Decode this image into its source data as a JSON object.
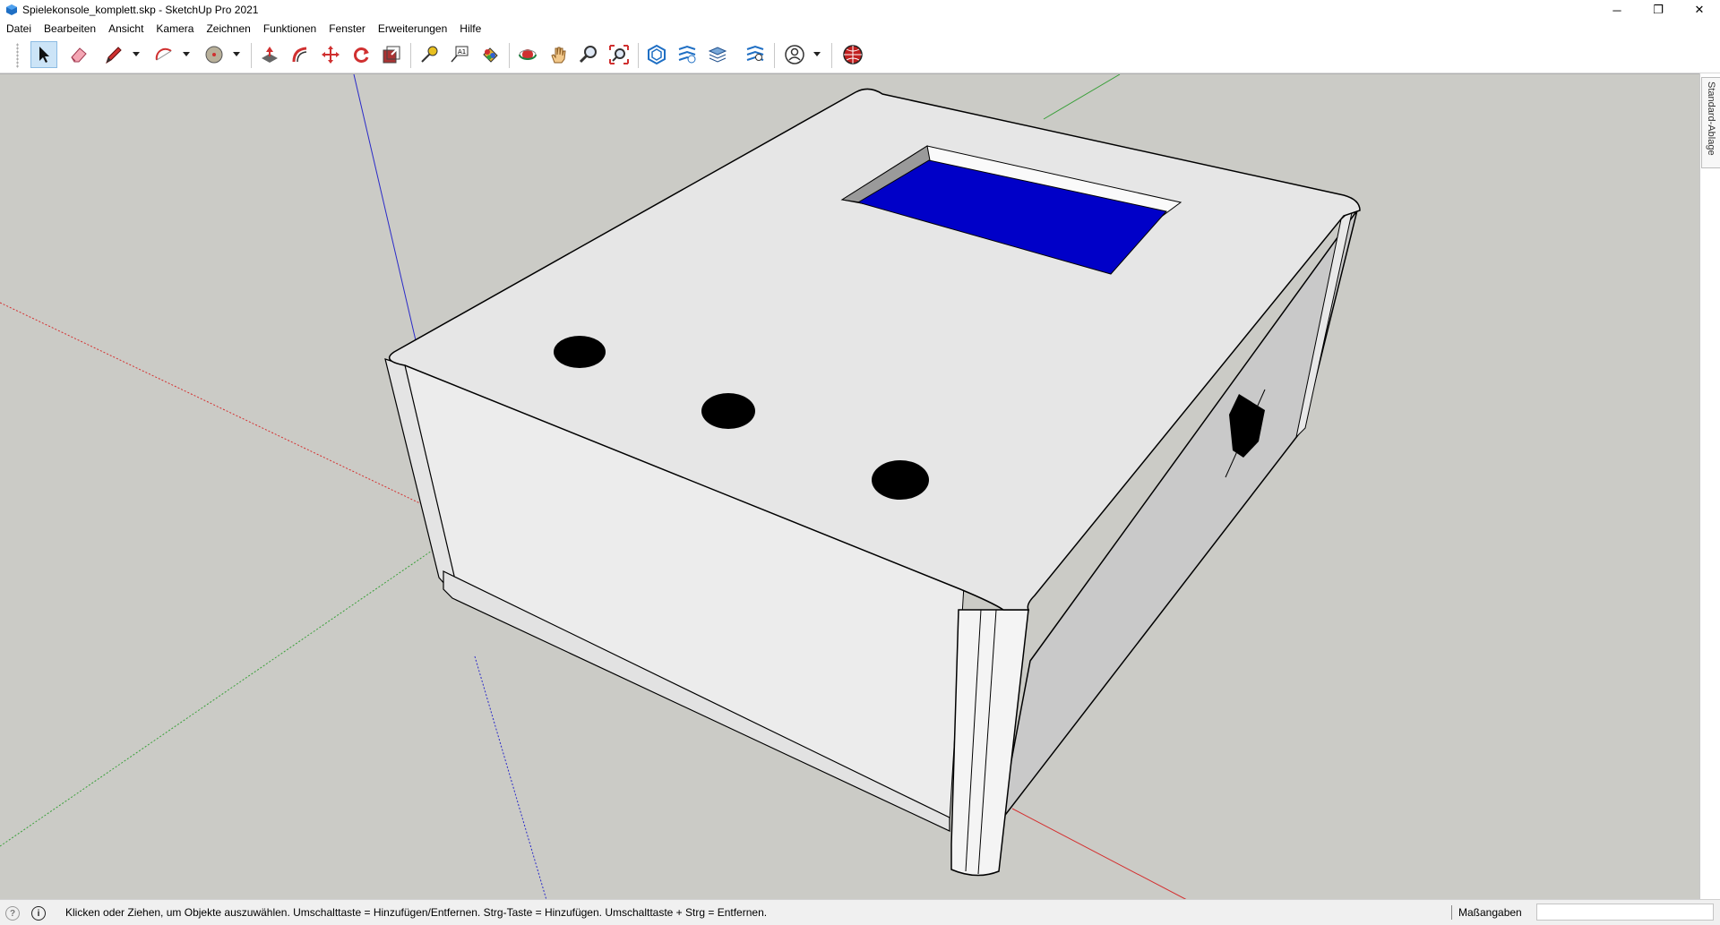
{
  "window": {
    "title": "Spielekonsole_komplett.skp - SketchUp Pro 2021",
    "controls": {
      "minimize": "─",
      "restore": "❐",
      "close": "✕"
    }
  },
  "menu": {
    "items": [
      {
        "label": "Datei"
      },
      {
        "label": "Bearbeiten"
      },
      {
        "label": "Ansicht"
      },
      {
        "label": "Kamera"
      },
      {
        "label": "Zeichnen"
      },
      {
        "label": "Funktionen"
      },
      {
        "label": "Fenster"
      },
      {
        "label": "Erweiterungen"
      },
      {
        "label": "Hilfe"
      }
    ]
  },
  "toolbar": {
    "tools": [
      {
        "name": "select-tool",
        "icon": "arrow-icon",
        "active": true
      },
      {
        "name": "eraser-tool",
        "icon": "eraser-icon"
      },
      {
        "name": "line-tool",
        "icon": "pencil-icon",
        "dropdown": true
      },
      {
        "name": "arc-tool",
        "icon": "arc-icon",
        "dropdown": true
      },
      {
        "name": "shape-tool",
        "icon": "circle-icon",
        "dropdown": true
      },
      {
        "name": "push-pull-tool",
        "icon": "push-pull-icon"
      },
      {
        "name": "offset-tool",
        "icon": "offset-icon"
      },
      {
        "name": "move-tool",
        "icon": "move-icon"
      },
      {
        "name": "rotate-tool",
        "icon": "rotate-icon"
      },
      {
        "name": "scale-tool",
        "icon": "scale-icon"
      },
      {
        "name": "tape-measure-tool",
        "icon": "tape-measure-icon"
      },
      {
        "name": "text-tool",
        "icon": "text-icon"
      },
      {
        "name": "paint-bucket-tool",
        "icon": "paint-bucket-icon"
      },
      {
        "name": "orbit-tool",
        "icon": "orbit-icon"
      },
      {
        "name": "pan-tool",
        "icon": "hand-icon"
      },
      {
        "name": "zoom-tool",
        "icon": "magnifier-icon"
      },
      {
        "name": "zoom-extents-tool",
        "icon": "zoom-extents-icon"
      },
      {
        "name": "3d-warehouse-button",
        "icon": "warehouse-icon"
      },
      {
        "name": "extension-warehouse-button",
        "icon": "extension-icon"
      },
      {
        "name": "layout-button",
        "icon": "layout-icon"
      },
      {
        "name": "extension-manager-button",
        "icon": "extension-manager-icon"
      },
      {
        "name": "account-button",
        "icon": "user-icon",
        "dropdown": true
      },
      {
        "name": "ruby-console-button",
        "icon": "globe-icon"
      }
    ],
    "text_tool_glyph": "A1"
  },
  "tray": {
    "tab_label": "Standard-Ablage"
  },
  "colors": {
    "viewport_bg": "#cbcbc6",
    "face_light": "#e6e6e6",
    "face_front": "#ededed",
    "face_side": "#c9c9c9",
    "display_blue": "#0000c8",
    "button_black": "#000000",
    "axis_red": "#d43030",
    "axis_green": "#3aa03a",
    "axis_blue": "#2a2ac8"
  },
  "status": {
    "message": "Klicken oder Ziehen, um Objekte auszuwählen. Umschalttaste = Hinzufügen/Entfernen. Strg-Taste = Hinzufügen. Umschalttaste + Strg = Entfernen.",
    "measurements_label": "Maßangaben",
    "measurements_value": ""
  }
}
